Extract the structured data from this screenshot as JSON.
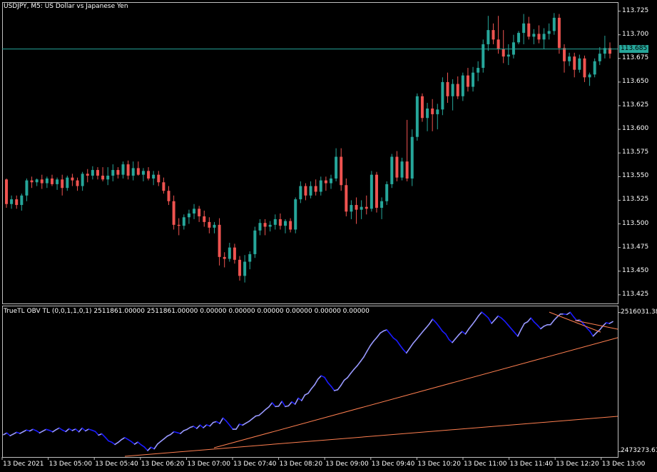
{
  "main": {
    "title": "USDJPY, M5:  US Dollar vs Japanese Yen",
    "current_price_label": "113.685"
  },
  "indicator": {
    "title": "TrueTL OBV TL (0,0,1,1,0,1) 2511861.00000 2511861.00000 0.00000 0.00000 0.00000 0.00000 0.00000 0.00000"
  },
  "colors": {
    "background": "#000000",
    "frame": "#c0c0c0",
    "bull": "#26a69a",
    "bear": "#ef5350",
    "price_line": "#26a69a",
    "obv_up": "#9999ff",
    "obv_down": "#1a1aff",
    "trendline": "#ff7f50"
  },
  "chart_data": [
    {
      "type": "candlestick",
      "symbol": "USDJPY",
      "timeframe": "M5",
      "ylim": [
        113.406,
        113.73
      ],
      "y_ticks": [
        "113.725",
        "113.700",
        "113.675",
        "113.650",
        "113.625",
        "113.600",
        "113.575",
        "113.550",
        "113.525",
        "113.500",
        "113.475",
        "113.450",
        "113.425"
      ],
      "current_price": 113.685,
      "candles": [
        [
          113.547,
          113.548,
          113.517,
          113.521
        ],
        [
          113.521,
          113.53,
          113.516,
          113.526
        ],
        [
          113.526,
          113.53,
          113.516,
          113.52
        ],
        [
          113.52,
          113.532,
          113.514,
          113.53
        ],
        [
          113.53,
          113.548,
          113.524,
          113.546
        ],
        [
          113.546,
          113.55,
          113.538,
          113.544
        ],
        [
          113.544,
          113.548,
          113.54,
          113.547
        ],
        [
          113.547,
          113.552,
          113.537,
          113.543
        ],
        [
          113.543,
          113.55,
          113.538,
          113.548
        ],
        [
          113.548,
          113.552,
          113.54,
          113.542
        ],
        [
          113.542,
          113.549,
          113.536,
          113.547
        ],
        [
          113.547,
          113.552,
          113.53,
          113.538
        ],
        [
          113.538,
          113.551,
          113.535,
          113.549
        ],
        [
          113.549,
          113.553,
          113.54,
          113.546
        ],
        [
          113.546,
          113.549,
          113.535,
          113.54
        ],
        [
          113.54,
          113.555,
          113.535,
          113.553
        ],
        [
          113.553,
          113.558,
          113.544,
          113.551
        ],
        [
          113.551,
          113.561,
          113.547,
          113.557
        ],
        [
          113.557,
          113.56,
          113.547,
          113.551
        ],
        [
          113.551,
          113.56,
          113.545,
          113.547
        ],
        [
          113.547,
          113.56,
          113.541,
          113.551
        ],
        [
          113.551,
          113.563,
          113.545,
          113.557
        ],
        [
          113.557,
          113.56,
          113.548,
          113.552
        ],
        [
          113.552,
          113.566,
          113.548,
          113.563
        ],
        [
          113.563,
          113.567,
          113.547,
          113.551
        ],
        [
          113.551,
          113.566,
          113.546,
          113.559
        ],
        [
          113.559,
          113.566,
          113.551,
          113.552
        ],
        [
          113.552,
          113.559,
          113.545,
          113.556
        ],
        [
          113.556,
          113.56,
          113.546,
          113.548
        ],
        [
          113.548,
          113.556,
          113.541,
          113.552
        ],
        [
          113.552,
          113.556,
          113.54,
          113.544
        ],
        [
          113.544,
          113.549,
          113.532,
          113.535
        ],
        [
          113.535,
          113.54,
          113.52,
          113.524
        ],
        [
          113.524,
          113.53,
          113.494,
          113.499
        ],
        [
          113.499,
          113.506,
          113.488,
          113.498
        ],
        [
          113.498,
          113.51,
          113.494,
          113.507
        ],
        [
          113.507,
          113.515,
          113.5,
          113.511
        ],
        [
          113.511,
          113.521,
          113.505,
          113.516
        ],
        [
          113.516,
          113.519,
          113.502,
          113.508
        ],
        [
          113.508,
          113.514,
          113.497,
          113.502
        ],
        [
          113.502,
          113.507,
          113.49,
          113.496
        ],
        [
          113.496,
          113.502,
          113.49,
          113.499
        ],
        [
          113.499,
          113.506,
          113.456,
          113.465
        ],
        [
          113.465,
          113.47,
          113.454,
          113.463
        ],
        [
          113.463,
          113.48,
          113.46,
          113.475
        ],
        [
          113.475,
          113.479,
          113.458,
          113.462
        ],
        [
          113.462,
          113.466,
          113.44,
          113.445
        ],
        [
          113.445,
          113.467,
          113.438,
          113.46
        ],
        [
          113.46,
          113.471,
          113.452,
          113.468
        ],
        [
          113.468,
          113.497,
          113.464,
          113.493
        ],
        [
          113.493,
          113.505,
          113.488,
          113.501
        ],
        [
          113.501,
          113.505,
          113.488,
          113.497
        ],
        [
          113.497,
          113.503,
          113.492,
          113.499
        ],
        [
          113.499,
          113.51,
          113.494,
          113.505
        ],
        [
          113.505,
          113.511,
          113.494,
          113.498
        ],
        [
          113.498,
          113.505,
          113.49,
          113.503
        ],
        [
          113.503,
          113.506,
          113.491,
          113.494
        ],
        [
          113.494,
          113.528,
          113.49,
          113.526
        ],
        [
          113.526,
          113.545,
          113.522,
          113.54
        ],
        [
          113.54,
          113.543,
          113.525,
          113.53
        ],
        [
          113.53,
          113.545,
          113.527,
          113.54
        ],
        [
          113.54,
          113.547,
          113.53,
          113.534
        ],
        [
          113.534,
          113.55,
          113.53,
          113.546
        ],
        [
          113.546,
          113.55,
          113.535,
          113.543
        ],
        [
          113.543,
          113.552,
          113.537,
          113.548
        ],
        [
          113.548,
          113.58,
          113.545,
          113.571
        ],
        [
          113.571,
          113.58,
          113.535,
          113.541
        ],
        [
          113.541,
          113.548,
          113.508,
          113.513
        ],
        [
          113.513,
          113.525,
          113.505,
          113.52
        ],
        [
          113.52,
          113.528,
          113.5,
          113.515
        ],
        [
          113.515,
          113.525,
          113.505,
          113.518
        ],
        [
          113.518,
          113.53,
          113.51,
          113.516
        ],
        [
          113.516,
          113.556,
          113.513,
          113.552
        ],
        [
          113.552,
          113.555,
          113.512,
          113.517
        ],
        [
          113.517,
          113.528,
          113.505,
          113.524
        ],
        [
          113.524,
          113.545,
          113.52,
          113.542
        ],
        [
          113.542,
          113.574,
          113.538,
          113.571
        ],
        [
          113.571,
          113.577,
          113.545,
          113.549
        ],
        [
          113.549,
          113.57,
          113.546,
          113.566
        ],
        [
          113.566,
          113.61,
          113.545,
          113.548
        ],
        [
          113.548,
          113.6,
          113.54,
          113.592
        ],
        [
          113.592,
          113.638,
          113.588,
          113.635
        ],
        [
          113.635,
          113.638,
          113.608,
          113.612
        ],
        [
          113.612,
          113.628,
          113.598,
          113.622
        ],
        [
          113.622,
          113.632,
          113.598,
          113.616
        ],
        [
          113.616,
          113.627,
          113.6,
          113.621
        ],
        [
          113.621,
          113.655,
          113.615,
          113.65
        ],
        [
          113.65,
          113.66,
          113.628,
          113.635
        ],
        [
          113.635,
          113.653,
          113.62,
          113.648
        ],
        [
          113.648,
          113.656,
          113.632,
          113.635
        ],
        [
          113.635,
          113.66,
          113.63,
          113.657
        ],
        [
          113.657,
          113.665,
          113.64,
          113.645
        ],
        [
          113.645,
          113.666,
          113.64,
          113.66
        ],
        [
          113.66,
          113.672,
          113.651,
          113.665
        ],
        [
          113.665,
          113.695,
          113.66,
          113.69
        ],
        [
          113.69,
          113.72,
          113.683,
          113.705
        ],
        [
          113.705,
          113.712,
          113.69,
          113.695
        ],
        [
          113.695,
          113.72,
          113.68,
          113.685
        ],
        [
          113.685,
          113.705,
          113.67,
          113.677
        ],
        [
          113.677,
          113.69,
          113.668,
          113.679
        ],
        [
          113.679,
          113.7,
          113.675,
          113.692
        ],
        [
          113.692,
          113.704,
          113.69,
          113.702
        ],
        [
          113.702,
          113.722,
          113.69,
          113.712
        ],
        [
          113.712,
          113.719,
          113.695,
          113.698
        ],
        [
          113.698,
          113.706,
          113.69,
          113.701
        ],
        [
          113.701,
          113.71,
          113.691,
          113.695
        ],
        [
          113.695,
          113.707,
          113.685,
          113.701
        ],
        [
          113.701,
          113.712,
          113.695,
          113.704
        ],
        [
          113.704,
          113.723,
          113.7,
          113.718
        ],
        [
          113.718,
          113.722,
          113.68,
          113.686
        ],
        [
          113.686,
          113.69,
          113.66,
          113.672
        ],
        [
          113.672,
          113.681,
          113.667,
          113.677
        ],
        [
          113.677,
          113.681,
          113.655,
          113.663
        ],
        [
          113.663,
          113.679,
          113.66,
          113.675
        ],
        [
          113.675,
          113.678,
          113.65,
          113.655
        ],
        [
          113.655,
          113.66,
          113.646,
          113.658
        ],
        [
          113.658,
          113.675,
          113.655,
          113.672
        ],
        [
          113.672,
          113.687,
          113.668,
          113.68
        ],
        [
          113.68,
          113.699,
          113.675,
          113.686
        ],
        [
          113.686,
          113.692,
          113.675,
          113.68
        ]
      ]
    },
    {
      "type": "line",
      "name": "TrueTL OBV TL",
      "ylim": [
        2471800,
        2517500
      ],
      "y_ticks": [
        "2516031.38",
        "2473273.61"
      ],
      "x_ticks": [
        "13 Dec 2021",
        "13 Dec 05:00",
        "13 Dec 05:40",
        "13 Dec 06:20",
        "13 Dec 07:00",
        "13 Dec 07:40",
        "13 Dec 08:20",
        "13 Dec 09:00",
        "13 Dec 09:40",
        "13 Dec 10:20",
        "13 Dec 11:00",
        "13 Dec 11:40",
        "13 Dec 12:20",
        "13 Dec 13:00"
      ],
      "obv": [
        2478450,
        2478980,
        2478130,
        2478660,
        2479190,
        2478820,
        2479350,
        2479880,
        2479590,
        2480110,
        2479660,
        2479000,
        2479550,
        2480080,
        2479780,
        2479320,
        2479970,
        2480510,
        2479850,
        2479410,
        2480280,
        2479730,
        2480190,
        2479330,
        2480480,
        2479610,
        2480160,
        2479810,
        2479430,
        2478310,
        2478720,
        2477690,
        2476560,
        2476150,
        2475440,
        2476090,
        2476930,
        2477560,
        2476970,
        2476330,
        2475530,
        2476170,
        2475330,
        2474650,
        2473560,
        2474580,
        2474100,
        2475560,
        2476390,
        2477190,
        2478010,
        2478500,
        2479360,
        2479100,
        2478810,
        2479690,
        2480070,
        2480700,
        2481030,
        2480370,
        2481410,
        2480600,
        2481480,
        2481110,
        2482200,
        2482490,
        2481880,
        2483600,
        2482630,
        2481420,
        2480140,
        2480140,
        2481690,
        2481400,
        2482000,
        2482590,
        2483390,
        2484180,
        2484400,
        2485270,
        2486200,
        2487000,
        2488260,
        2487100,
        2487230,
        2488720,
        2487100,
        2487320,
        2488540,
        2487840,
        2489700,
        2488930,
        2490670,
        2491180,
        2492620,
        2493840,
        2495550,
        2496580,
        2496090,
        2494490,
        2493350,
        2492010,
        2492270,
        2493610,
        2495200,
        2496000,
        2497350,
        2498580,
        2499690,
        2501020,
        2502390,
        2504180,
        2505880,
        2507250,
        2508400,
        2509710,
        2510350,
        2510720,
        2509470,
        2508210,
        2507460,
        2506020,
        2504670,
        2503580,
        2505040,
        2506510,
        2507700,
        2508940,
        2510170,
        2511330,
        2512540,
        2514000,
        2512960,
        2511690,
        2510280,
        2509400,
        2507720,
        2506800,
        2507990,
        2509190,
        2510210,
        2509420,
        2510930,
        2512190,
        2513530,
        2515000,
        2516150,
        2515320,
        2514380,
        2512700,
        2513840,
        2514970,
        2514340,
        2513400,
        2512240,
        2511060,
        2509910,
        2508750,
        2510790,
        2512650,
        2513190,
        2514370,
        2513110,
        2512150,
        2511050,
        2511830,
        2512270,
        2512300,
        2513580,
        2514660,
        2515570,
        2515580,
        2515440,
        2516090,
        2514770,
        2513580,
        2513720,
        2512570,
        2511370,
        2510300,
        2508790,
        2509810,
        2510700,
        2511920,
        2512890,
        2512670,
        2513240
      ]
    }
  ]
}
